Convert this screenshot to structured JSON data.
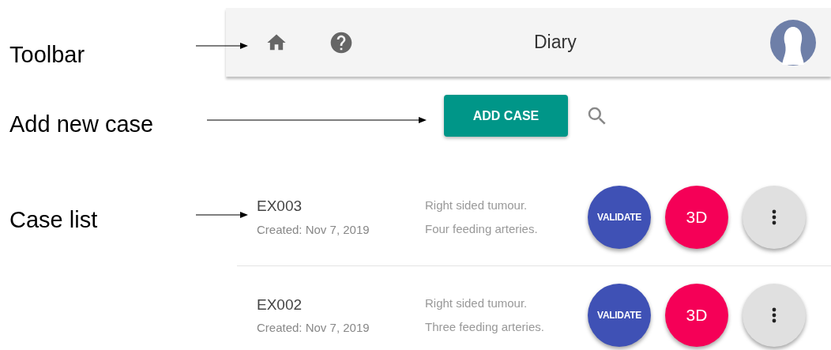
{
  "annotations": [
    {
      "label": "Toolbar"
    },
    {
      "label": "Add new case"
    },
    {
      "label": "Case list"
    }
  ],
  "toolbar": {
    "title": "Diary"
  },
  "add_button": {
    "label": "ADD CASE"
  },
  "cases": [
    {
      "id": "EX003",
      "created": "Created: Nov 7, 2019",
      "description": "Right sided tumour. Four feeding arteries.",
      "actions": {
        "validate": "VALIDATE",
        "view3d": "3D"
      }
    },
    {
      "id": "EX002",
      "created": "Created: Nov 7, 2019",
      "description": "Right sided tumour. Three feeding arteries.",
      "actions": {
        "validate": "VALIDATE",
        "view3d": "3D"
      }
    }
  ]
}
